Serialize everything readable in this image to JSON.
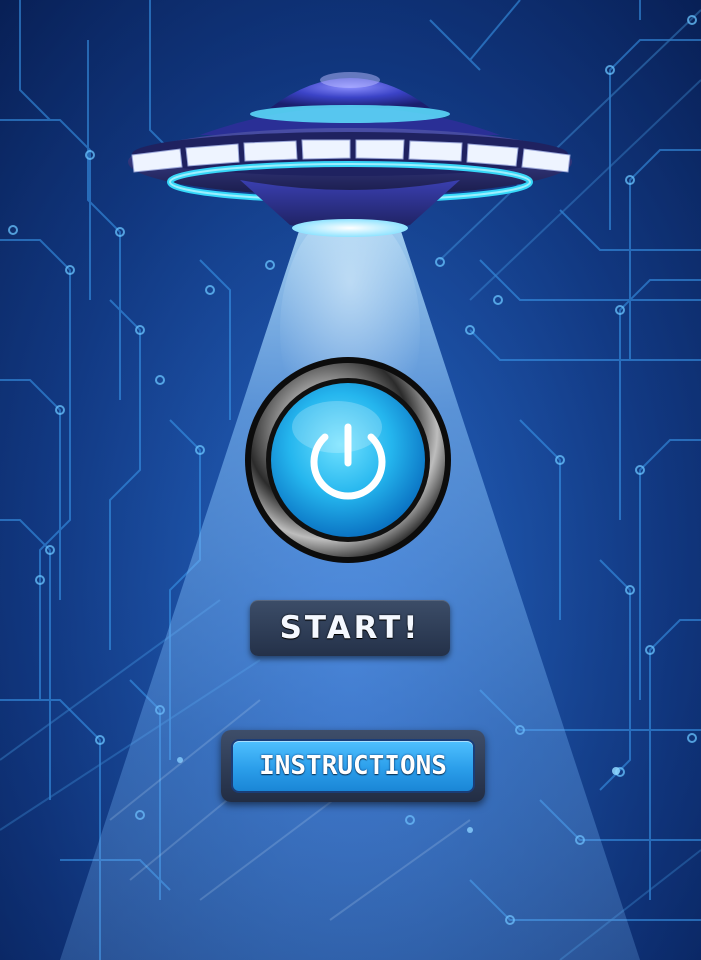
{
  "screen": {
    "name": "main-menu"
  },
  "buttons": {
    "start_label": "START!",
    "instructions_label": "INSTRUCTIONS"
  },
  "icons": {
    "ufo": "ufo-icon",
    "power": "power-icon"
  },
  "colors": {
    "background_dark": "#0a2562",
    "background_mid": "#174a9e",
    "circuit_line": "#3fa7ff",
    "power_button_fill": "#2fc3f5",
    "instructions_fill": "#2b9eea",
    "start_plate": "#2f3d57"
  }
}
